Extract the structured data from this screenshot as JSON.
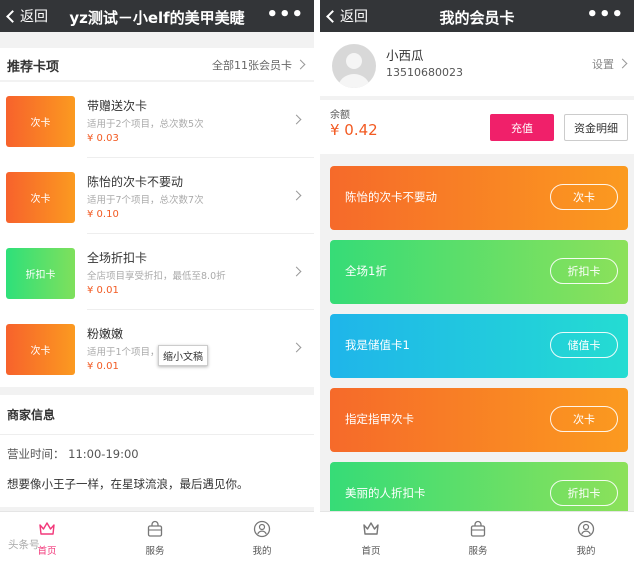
{
  "left": {
    "nav": {
      "back": "返回",
      "title": "yz测试－小elf的美甲美睫",
      "more": "•••"
    },
    "recommended": {
      "title": "推荐卡项",
      "all_cards": "全部11张会员卡",
      "items": [
        {
          "thumb": "次卡",
          "name": "带赠送次卡",
          "desc": "适用于2个项目，总次数5次",
          "price": "¥ 0.03",
          "color": "orange"
        },
        {
          "thumb": "次卡",
          "name": "陈怡的次卡不要动",
          "desc": "适用于7个项目，总次数7次",
          "price": "¥ 0.10",
          "color": "orange"
        },
        {
          "thumb": "折扣卡",
          "name": "全场折扣卡",
          "desc": "全店项目享受折扣，最低至8.0折",
          "price": "¥ 0.01",
          "color": "green"
        },
        {
          "thumb": "次卡",
          "name": "粉嫩嫩",
          "desc": "适用于1个项目，",
          "price": "¥ 0.01",
          "color": "orange"
        }
      ],
      "tooltip": "缩小文稿"
    },
    "merchant": {
      "title": "商家信息",
      "hours": "营业时间：  11:00-19:00",
      "motto": "想要像小王子一样，在星球流浪，最后遇见你。"
    },
    "tabs": [
      {
        "label": "首页",
        "icon": "crown-icon",
        "active": true
      },
      {
        "label": "服务",
        "icon": "bag-icon",
        "active": false
      },
      {
        "label": "我的",
        "icon": "user-icon",
        "active": false
      }
    ],
    "watermark": "头条号"
  },
  "right": {
    "nav": {
      "back": "返回",
      "title": "我的会员卡",
      "more": "•••"
    },
    "profile": {
      "name": "小西瓜",
      "phone": "13510680023",
      "settings": "设置"
    },
    "balance": {
      "label": "余额",
      "amount": "¥ 0.42",
      "recharge": "充值",
      "details": "资金明细"
    },
    "cards": [
      {
        "name": "陈怡的次卡不要动",
        "type": "次卡",
        "color": "orange"
      },
      {
        "name": "全场1折",
        "type": "折扣卡",
        "color": "green"
      },
      {
        "name": "我是储值卡1",
        "type": "储值卡",
        "color": "blue"
      },
      {
        "name": "指定指甲次卡",
        "type": "次卡",
        "color": "orange"
      },
      {
        "name": "美丽的人折扣卡",
        "type": "折扣卡",
        "color": "green"
      }
    ],
    "tabs": [
      {
        "label": "首页",
        "icon": "crown-icon"
      },
      {
        "label": "服务",
        "icon": "bag-icon"
      },
      {
        "label": "我的",
        "icon": "user-icon"
      }
    ]
  },
  "colors": {
    "navbar": "#333538",
    "accent_pink": "#f0206a",
    "price_orange": "#f25a22",
    "card_orange": "#f66a2a",
    "card_green": "#36dc77",
    "card_blue": "#1fb5ea"
  }
}
